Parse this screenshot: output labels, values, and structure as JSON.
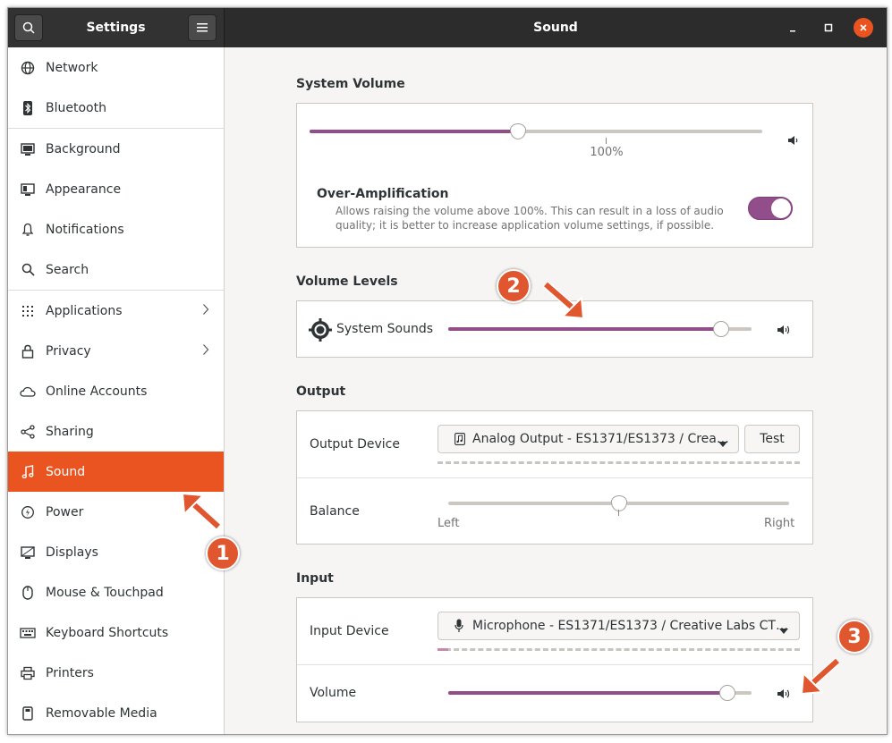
{
  "header": {
    "sidebar_title": "Settings",
    "page_title": "Sound"
  },
  "sidebar": {
    "items": [
      {
        "label": "Network",
        "icon": "network-icon"
      },
      {
        "label": "Bluetooth",
        "icon": "bluetooth-icon"
      },
      {
        "label": "Background",
        "icon": "background-icon"
      },
      {
        "label": "Appearance",
        "icon": "appearance-icon"
      },
      {
        "label": "Notifications",
        "icon": "bell-icon"
      },
      {
        "label": "Search",
        "icon": "search-icon"
      },
      {
        "label": "Applications",
        "icon": "grid-icon"
      },
      {
        "label": "Privacy",
        "icon": "lock-icon"
      },
      {
        "label": "Online Accounts",
        "icon": "cloud-icon"
      },
      {
        "label": "Sharing",
        "icon": "share-icon"
      },
      {
        "label": "Sound",
        "icon": "music-note-icon",
        "active": true
      },
      {
        "label": "Power",
        "icon": "power-icon"
      },
      {
        "label": "Displays",
        "icon": "display-icon"
      },
      {
        "label": "Mouse & Touchpad",
        "icon": "mouse-icon"
      },
      {
        "label": "Keyboard Shortcuts",
        "icon": "keyboard-icon"
      },
      {
        "label": "Printers",
        "icon": "printer-icon"
      },
      {
        "label": "Removable Media",
        "icon": "removable-media-icon"
      }
    ]
  },
  "system_volume": {
    "title": "System Volume",
    "level": 0.46,
    "mark_label": "100%",
    "over_amp_title": "Over-Amplification",
    "over_amp_desc_line1": "Allows raising the volume above 100%. This can result in a loss of audio",
    "over_amp_desc_line2": "quality; it is better to increase application volume settings, if possible.",
    "over_amp_enabled": true
  },
  "volume_levels": {
    "title": "Volume Levels",
    "item_label": "System Sounds",
    "level": 0.9
  },
  "output": {
    "title": "Output",
    "device_label": "Output Device",
    "device_value": "Analog Output - ES1371/ES1373 / Crea…",
    "test_button": "Test",
    "balance_label": "Balance",
    "balance_value": 0.5,
    "balance_left": "Left",
    "balance_right": "Right"
  },
  "input": {
    "title": "Input",
    "device_label": "Input Device",
    "device_value": "Microphone - ES1371/ES1373 / Creative Labs CT…",
    "volume_label": "Volume",
    "level": 0.92
  },
  "annotations": [
    "1",
    "2",
    "3"
  ],
  "colors": {
    "accent": "#e95420",
    "slider_fill": "#924d8b",
    "badge": "#e0572f"
  }
}
